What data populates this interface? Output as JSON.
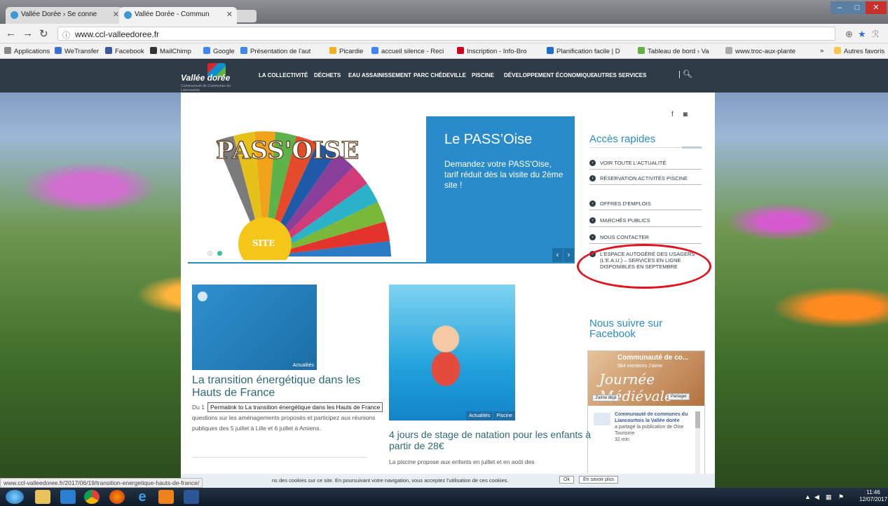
{
  "browser": {
    "tabs": [
      {
        "label": "Vallée Dorée › Se conne"
      },
      {
        "label": "Vallée Dorée - Commun"
      }
    ],
    "url": "www.ccl-valleedoree.fr",
    "window_controls": [
      "–",
      "□",
      "✕"
    ],
    "bookmarks": [
      {
        "label": "Applications",
        "color": "#888888"
      },
      {
        "label": "WeTransfer",
        "color": "#3d6fd1"
      },
      {
        "label": "Facebook",
        "color": "#3b5998"
      },
      {
        "label": "MailChimp",
        "color": "#333333"
      },
      {
        "label": "Google",
        "color": "#4285f4"
      },
      {
        "label": "Présentation de l'aut",
        "color": "#4285f4"
      },
      {
        "label": "Picardie",
        "color": "#f2b01e"
      },
      {
        "label": "accueil silence - Reci",
        "color": "#4285f4"
      },
      {
        "label": "Inscription - Info-Bro",
        "color": "#d0021b"
      },
      {
        "label": "Planification facile | D",
        "color": "#1f6dc9"
      },
      {
        "label": "Tableau de bord › Va",
        "color": "#63b046"
      },
      {
        "label": "www.troc-aux-plante",
        "color": "#aaaaaa"
      },
      {
        "label": "Autres favoris",
        "color": "#f2c94c"
      }
    ]
  },
  "site": {
    "logo_text": "Vallée dorée",
    "logo_sub": "Communauté de Communes du Liancourtois",
    "nav": [
      "LA COLLECTIVITÉ",
      "DÉCHETS",
      "EAU ASSAINISSEMENT",
      "PARC CHÈDEVILLE",
      "PISCINE",
      "DÉVELOPPEMENT ÉCONOMIQUE",
      "AUTRES SERVICES"
    ],
    "nav_sep": "|",
    "slider": {
      "title": "Le PASS’Oise",
      "text": "Demandez votre PASS'Oise, tarif réduit dès la visite du 2ème site !",
      "prev": "‹",
      "next": "›",
      "fan_text": "PASS'OISE",
      "badge": "SITE"
    },
    "acces_title": "Accès rapides",
    "quick_links": [
      "VOIR TOUTE L'ACTUALITÉ",
      "RÉSERVATION ACTIVITÉS PISCINE",
      "OFFRES D'EMPLOIS",
      "MARCHÉS PUBLICS",
      "NOUS CONTACTER",
      "L'ESPACE AUTOGÉRÉ DES USAGERS (L'E.A.U.) – SERVICES EN LIGNE DISPONIBLES EN SEPTEMBRE"
    ],
    "facebook": {
      "title": "Nous suivre sur Facebook",
      "page_name": "Communauté de co...",
      "fans": "584 mentions J'aime",
      "banner_text": "Journée Médiévale",
      "like_btn": "J'aime déjà",
      "share_btn": "Partager",
      "post_author": "Communauté de communes du Liancourtois la Vallée dorée",
      "post_action": "a partagé la publication de Oise Tourisme",
      "post_time": "32 min"
    },
    "posts": [
      {
        "tag": "Actualités",
        "title": "La transition énergétique dans les Hauts de France",
        "text_start": "Du 1",
        "text": "questions sur les aménagements proposés et participez aux réunions publiques des 5 juillet à Lille et 6 juillet à Amiens.",
        "tooltip": "Permalink to La transition énergétique dans les Hauts de France"
      },
      {
        "tags": [
          "Actualités",
          "Piscine"
        ],
        "title": "4 jours de stage de natation pour les enfants à partir de 28€",
        "text": "La piscine propose aux enfants en juillet et en août des"
      }
    ],
    "cookie": {
      "text": "ns des cookies sur ce site. En poursuivant votre navigation, vous acceptez l'utilisation de ces cookies.",
      "ok": "Ok",
      "more": "En savoir plus"
    }
  },
  "status_url": "www.ccl-valleedoree.fr/2017/06/19/transition-energetique-hauts-de-france/",
  "taskbar": {
    "time": "11:46",
    "date": "12/07/2017"
  },
  "colors": {
    "accent": "#2a8bcb",
    "nav_bg": "#2e3b47",
    "highlight": "#e3131d"
  }
}
